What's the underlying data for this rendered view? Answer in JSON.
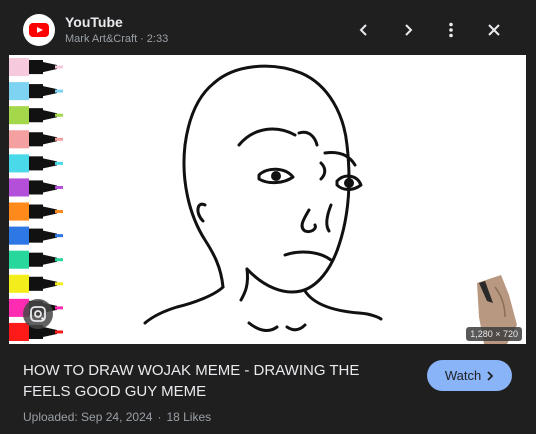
{
  "header": {
    "source_name": "YouTube",
    "channel": "Mark Art&Craft",
    "separator": "·",
    "duration": "2:33",
    "icons": [
      "youtube-logo-icon",
      "chevron-left-icon",
      "chevron-right-icon",
      "more-vert-icon",
      "close-icon"
    ]
  },
  "image": {
    "resolution": "1,280 × 720",
    "marker_colors": [
      "#f6c9dc",
      "#7fd3f2",
      "#a4d84a",
      "#f4a0a0",
      "#49d9e8",
      "#b34fd9",
      "#ff8a1c",
      "#2e78e6",
      "#28d79c",
      "#f4ed1c",
      "#ff2bb0",
      "#ff1a1a"
    ]
  },
  "details": {
    "title": "HOW TO DRAW WOJAK MEME - DRAWING THE FEELS GOOD GUY MEME",
    "watch_label": "Watch",
    "uploaded": "Uploaded: Sep 24, 2024",
    "separator": "·",
    "likes": "18 Likes"
  },
  "colors": {
    "background": "#1f1f1f",
    "accent": "#8ab4f8",
    "youtube_red": "#ff0000"
  }
}
